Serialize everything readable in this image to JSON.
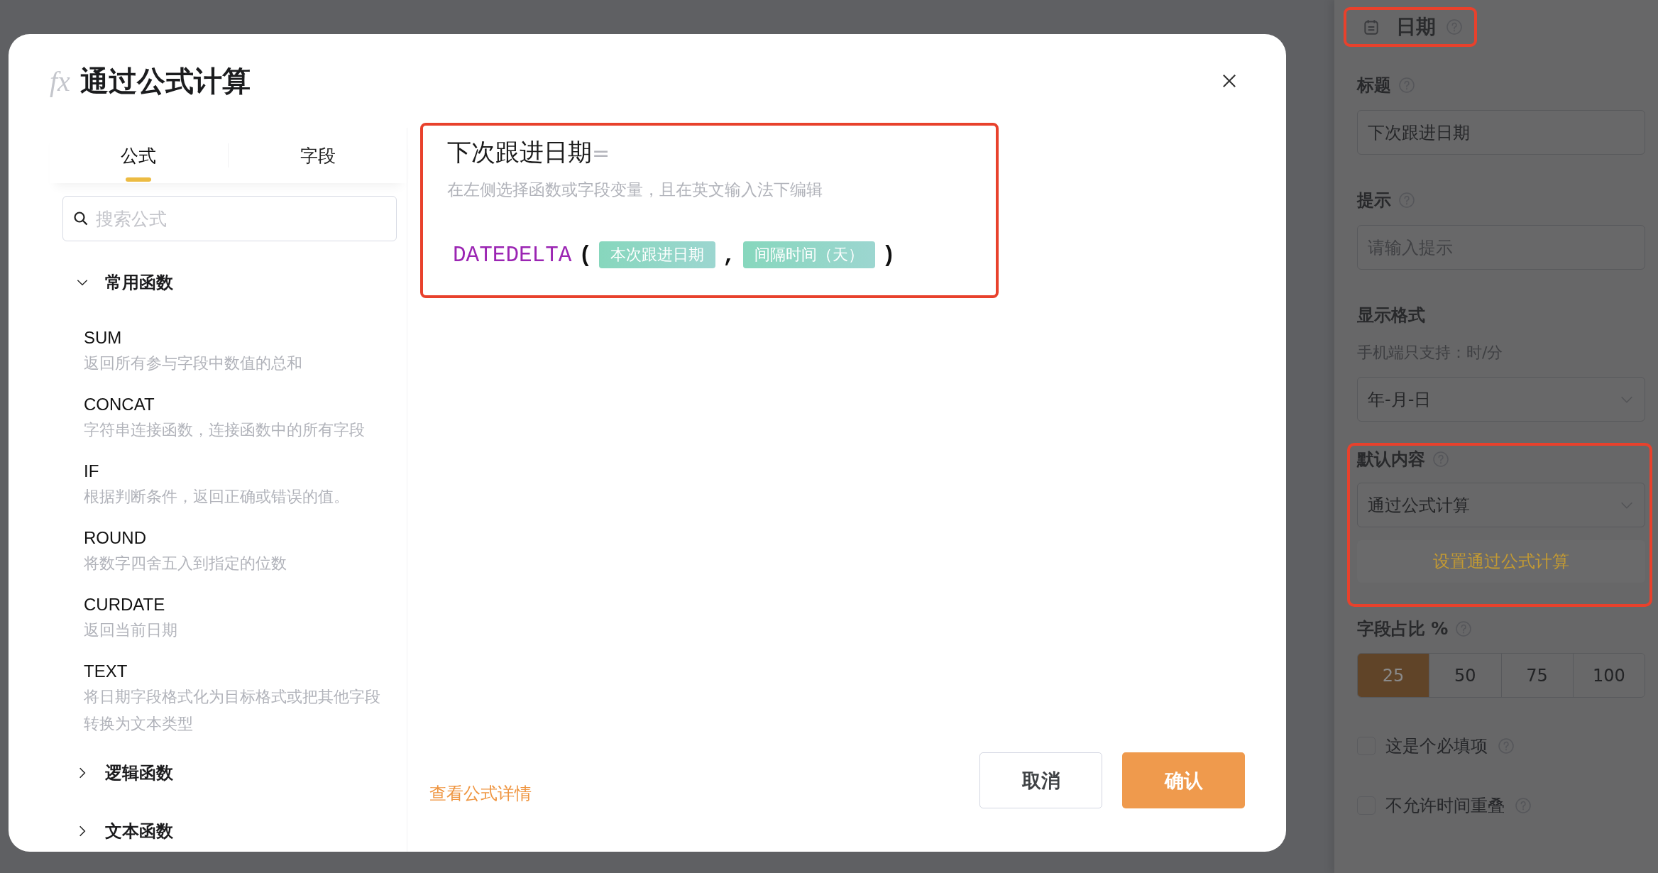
{
  "settings_panel": {
    "header": {
      "label": "日期"
    },
    "title_field": {
      "label": "标题",
      "value": "下次跟进日期"
    },
    "hint_field": {
      "label": "提示",
      "placeholder": "请输入提示"
    },
    "format_field": {
      "label": "显示格式",
      "note": "手机端只支持：时/分",
      "value": "年-月-日"
    },
    "default_field": {
      "label": "默认内容",
      "value": "通过公式计算",
      "button": "设置通过公式计算"
    },
    "width_field": {
      "label": "字段占比 %",
      "options": [
        {
          "label": "25",
          "selected": true
        },
        {
          "label": "50",
          "selected": false
        },
        {
          "label": "75",
          "selected": false
        },
        {
          "label": "100",
          "selected": false
        }
      ]
    },
    "checkboxes": [
      {
        "label": "这是个必填项",
        "checked": false
      },
      {
        "label": "不允许时间重叠",
        "checked": false
      }
    ]
  },
  "dialog": {
    "icon_text": "fx",
    "title": "通过公式计算",
    "tabs": [
      {
        "label": "公式",
        "selected": true
      },
      {
        "label": "字段",
        "selected": false
      }
    ],
    "search": {
      "placeholder": "搜索公式"
    },
    "groups": [
      {
        "title": "常用函数",
        "expanded": true,
        "functions": [
          {
            "name": "SUM",
            "description": "返回所有参与字段中数值的总和"
          },
          {
            "name": "CONCAT",
            "description": "字符串连接函数，连接函数中的所有字段"
          },
          {
            "name": "IF",
            "description": "根据判断条件，返回正确或错误的值。"
          },
          {
            "name": "ROUND",
            "description": "将数字四舍五入到指定的位数"
          },
          {
            "name": "CURDATE",
            "description": "返回当前日期"
          },
          {
            "name": "TEXT",
            "description": "将日期字段格式化为目标格式或把其他字段转换为文本类型"
          }
        ]
      },
      {
        "title": "逻辑函数",
        "expanded": false
      },
      {
        "title": "文本函数",
        "expanded": false
      }
    ],
    "editor": {
      "target": "下次跟进日期",
      "equals": "=",
      "hint": "在左侧选择函数或字段变量，且在英文输入法下编辑",
      "formula": [
        {
          "kind": "function",
          "text": "DATEDELTA"
        },
        {
          "kind": "paren",
          "text": "("
        },
        {
          "kind": "field",
          "text": "本次跟进日期"
        },
        {
          "kind": "comma",
          "text": ","
        },
        {
          "kind": "field",
          "text": "间隔时间（天）"
        },
        {
          "kind": "paren",
          "text": ")"
        }
      ]
    },
    "details_link": "查看公式详情",
    "buttons": [
      {
        "label": "取消",
        "kind": "secondary"
      },
      {
        "label": "确认",
        "kind": "primary"
      }
    ]
  }
}
